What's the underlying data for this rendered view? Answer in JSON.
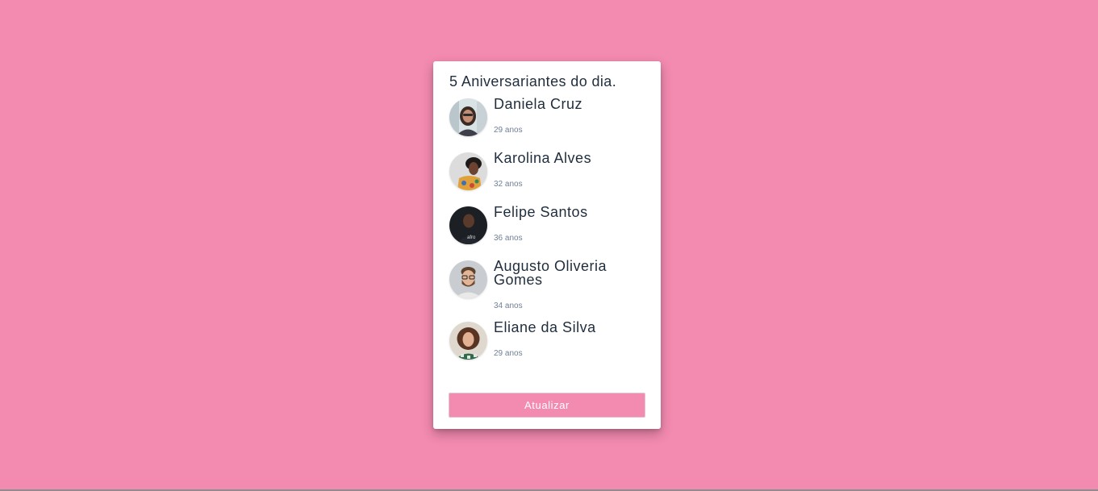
{
  "card": {
    "title": "5 Aniversariantes do dia.",
    "people": [
      {
        "name": "Daniela Cruz",
        "age": "29 anos",
        "avatar_icon": "woman-with-glasses-photo"
      },
      {
        "name": "Karolina Alves",
        "age": "32 anos",
        "avatar_icon": "woman-colorful-top-photo"
      },
      {
        "name": "Felipe Santos",
        "age": "36 anos",
        "avatar_icon": "man-dark-background-photo"
      },
      {
        "name": "Augusto Oliveria Gomes",
        "age": "34 anos",
        "avatar_icon": "bearded-man-with-glasses-photo"
      },
      {
        "name": "Eliane da Silva",
        "age": "29 anos",
        "avatar_icon": "curly-haired-woman-photo"
      }
    ],
    "button_label": "Atualizar"
  },
  "colors": {
    "background": "#f38ab0",
    "card": "#ffffff",
    "text": "#1f2d3d",
    "muted_text": "#6f7f96",
    "button": "#f38ab0"
  }
}
